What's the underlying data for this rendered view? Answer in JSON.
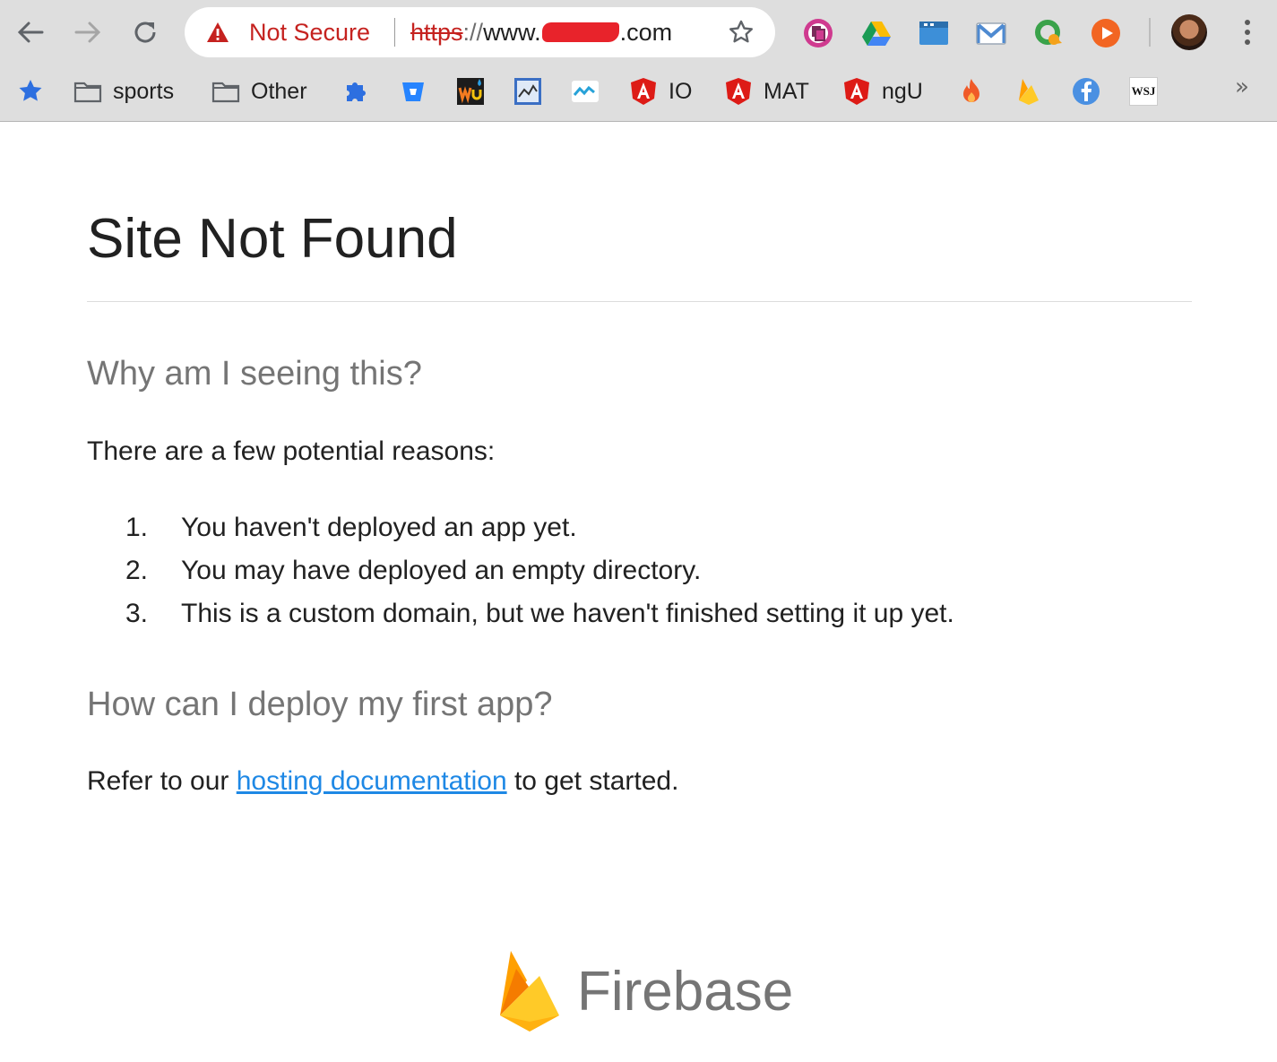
{
  "browser": {
    "security_label": "Not Secure",
    "url": {
      "scheme": "https",
      "separator": "://",
      "host_prefix": "www.",
      "host_suffix": ".com"
    },
    "bookmarks": [
      {
        "type": "star",
        "label": ""
      },
      {
        "type": "folder",
        "label": "sports"
      },
      {
        "type": "folder",
        "label": "Other"
      },
      {
        "type": "puzzle",
        "label": ""
      },
      {
        "type": "bitbucket",
        "label": ""
      },
      {
        "type": "wu",
        "label": ""
      },
      {
        "type": "chart",
        "label": ""
      },
      {
        "type": "wave",
        "label": ""
      },
      {
        "type": "angular",
        "label": "IO"
      },
      {
        "type": "angular",
        "label": "MAT"
      },
      {
        "type": "angular",
        "label": "ngU"
      },
      {
        "type": "flame",
        "label": ""
      },
      {
        "type": "firebase",
        "label": ""
      },
      {
        "type": "facebook",
        "label": ""
      },
      {
        "type": "wsj",
        "label": "WSJ"
      }
    ],
    "overflow_label": "»"
  },
  "page": {
    "title": "Site Not Found",
    "why_heading": "Why am I seeing this?",
    "intro": "There are a few potential reasons:",
    "reasons": [
      {
        "num": "1.",
        "text": "You haven't deployed an app yet."
      },
      {
        "num": "2.",
        "text": "You may have deployed an empty directory."
      },
      {
        "num": "3.",
        "text": "This is a custom domain, but we haven't finished setting it up yet."
      }
    ],
    "how_heading": "How can I deploy my first app?",
    "refer_prefix": "Refer to our ",
    "refer_link": "hosting documentation",
    "refer_suffix": " to get started."
  },
  "footer": {
    "brand": "Firebase"
  },
  "colors": {
    "warning_red": "#c5221f",
    "link_blue": "#1e88e5",
    "heading_gray": "#757575",
    "chrome_gray": "#dedede"
  }
}
